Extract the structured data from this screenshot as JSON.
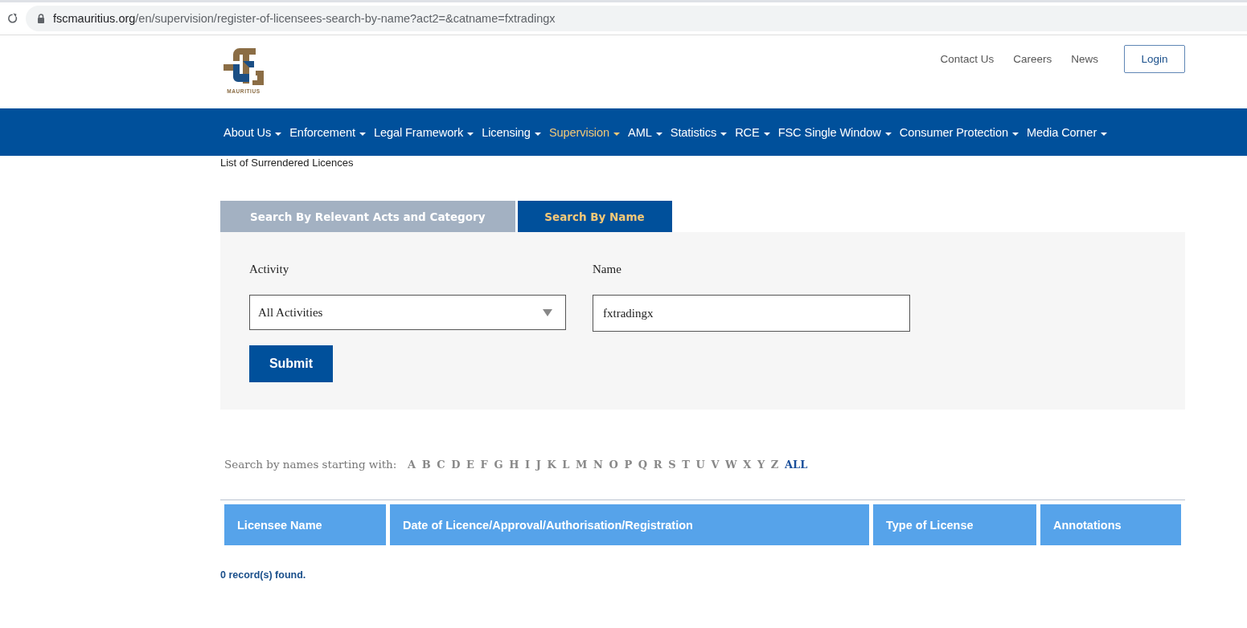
{
  "browser": {
    "url_host": "fscmauritius.org",
    "url_path": "/en/supervision/register-of-licensees-search-by-name?act2=&catname=fxtradingx"
  },
  "header": {
    "logo_text": "MAURITIUS",
    "links": [
      "Contact Us",
      "Careers",
      "News"
    ],
    "login": "Login"
  },
  "nav": [
    {
      "label": "About Us",
      "selected": false
    },
    {
      "label": "Enforcement",
      "selected": false
    },
    {
      "label": "Legal Framework",
      "selected": false
    },
    {
      "label": "Licensing",
      "selected": false
    },
    {
      "label": "Supervision",
      "selected": true
    },
    {
      "label": "AML",
      "selected": false
    },
    {
      "label": "Statistics",
      "selected": false
    },
    {
      "label": "RCE",
      "selected": false
    },
    {
      "label": "FSC Single Window",
      "selected": false
    },
    {
      "label": "Consumer Protection",
      "selected": false
    },
    {
      "label": "Media Corner",
      "selected": false
    }
  ],
  "breadcrumb_text": "List of Surrendered Licences",
  "tabs": [
    {
      "label": "Search By Relevant Acts and Category",
      "selected": false
    },
    {
      "label": "Search By Name",
      "selected": true
    }
  ],
  "form": {
    "activity_label": "Activity",
    "activity_value": "All Activities",
    "name_label": "Name",
    "name_value": "fxtradingx",
    "submit": "Submit"
  },
  "letters": {
    "label": "Search by names starting with:",
    "items": [
      {
        "label": "A",
        "selected": false
      },
      {
        "label": "B",
        "selected": false
      },
      {
        "label": "C",
        "selected": false
      },
      {
        "label": "D",
        "selected": false
      },
      {
        "label": "E",
        "selected": false
      },
      {
        "label": "F",
        "selected": false
      },
      {
        "label": "G",
        "selected": false
      },
      {
        "label": "H",
        "selected": false
      },
      {
        "label": "I",
        "selected": false
      },
      {
        "label": "J",
        "selected": false
      },
      {
        "label": "K",
        "selected": false
      },
      {
        "label": "L",
        "selected": false
      },
      {
        "label": "M",
        "selected": false
      },
      {
        "label": "N",
        "selected": false
      },
      {
        "label": "O",
        "selected": false
      },
      {
        "label": "P",
        "selected": false
      },
      {
        "label": "Q",
        "selected": false
      },
      {
        "label": "R",
        "selected": false
      },
      {
        "label": "S",
        "selected": false
      },
      {
        "label": "T",
        "selected": false
      },
      {
        "label": "U",
        "selected": false
      },
      {
        "label": "V",
        "selected": false
      },
      {
        "label": "W",
        "selected": false
      },
      {
        "label": "X",
        "selected": false
      },
      {
        "label": "Y",
        "selected": false
      },
      {
        "label": "Z",
        "selected": false
      },
      {
        "label": "ALL",
        "selected": true
      }
    ]
  },
  "table": {
    "columns": [
      "Licensee Name",
      "Date of Licence/Approval/Authorisation/Registration",
      "Type of License",
      "Annotations"
    ]
  },
  "result_text": "0 record(s) found."
}
